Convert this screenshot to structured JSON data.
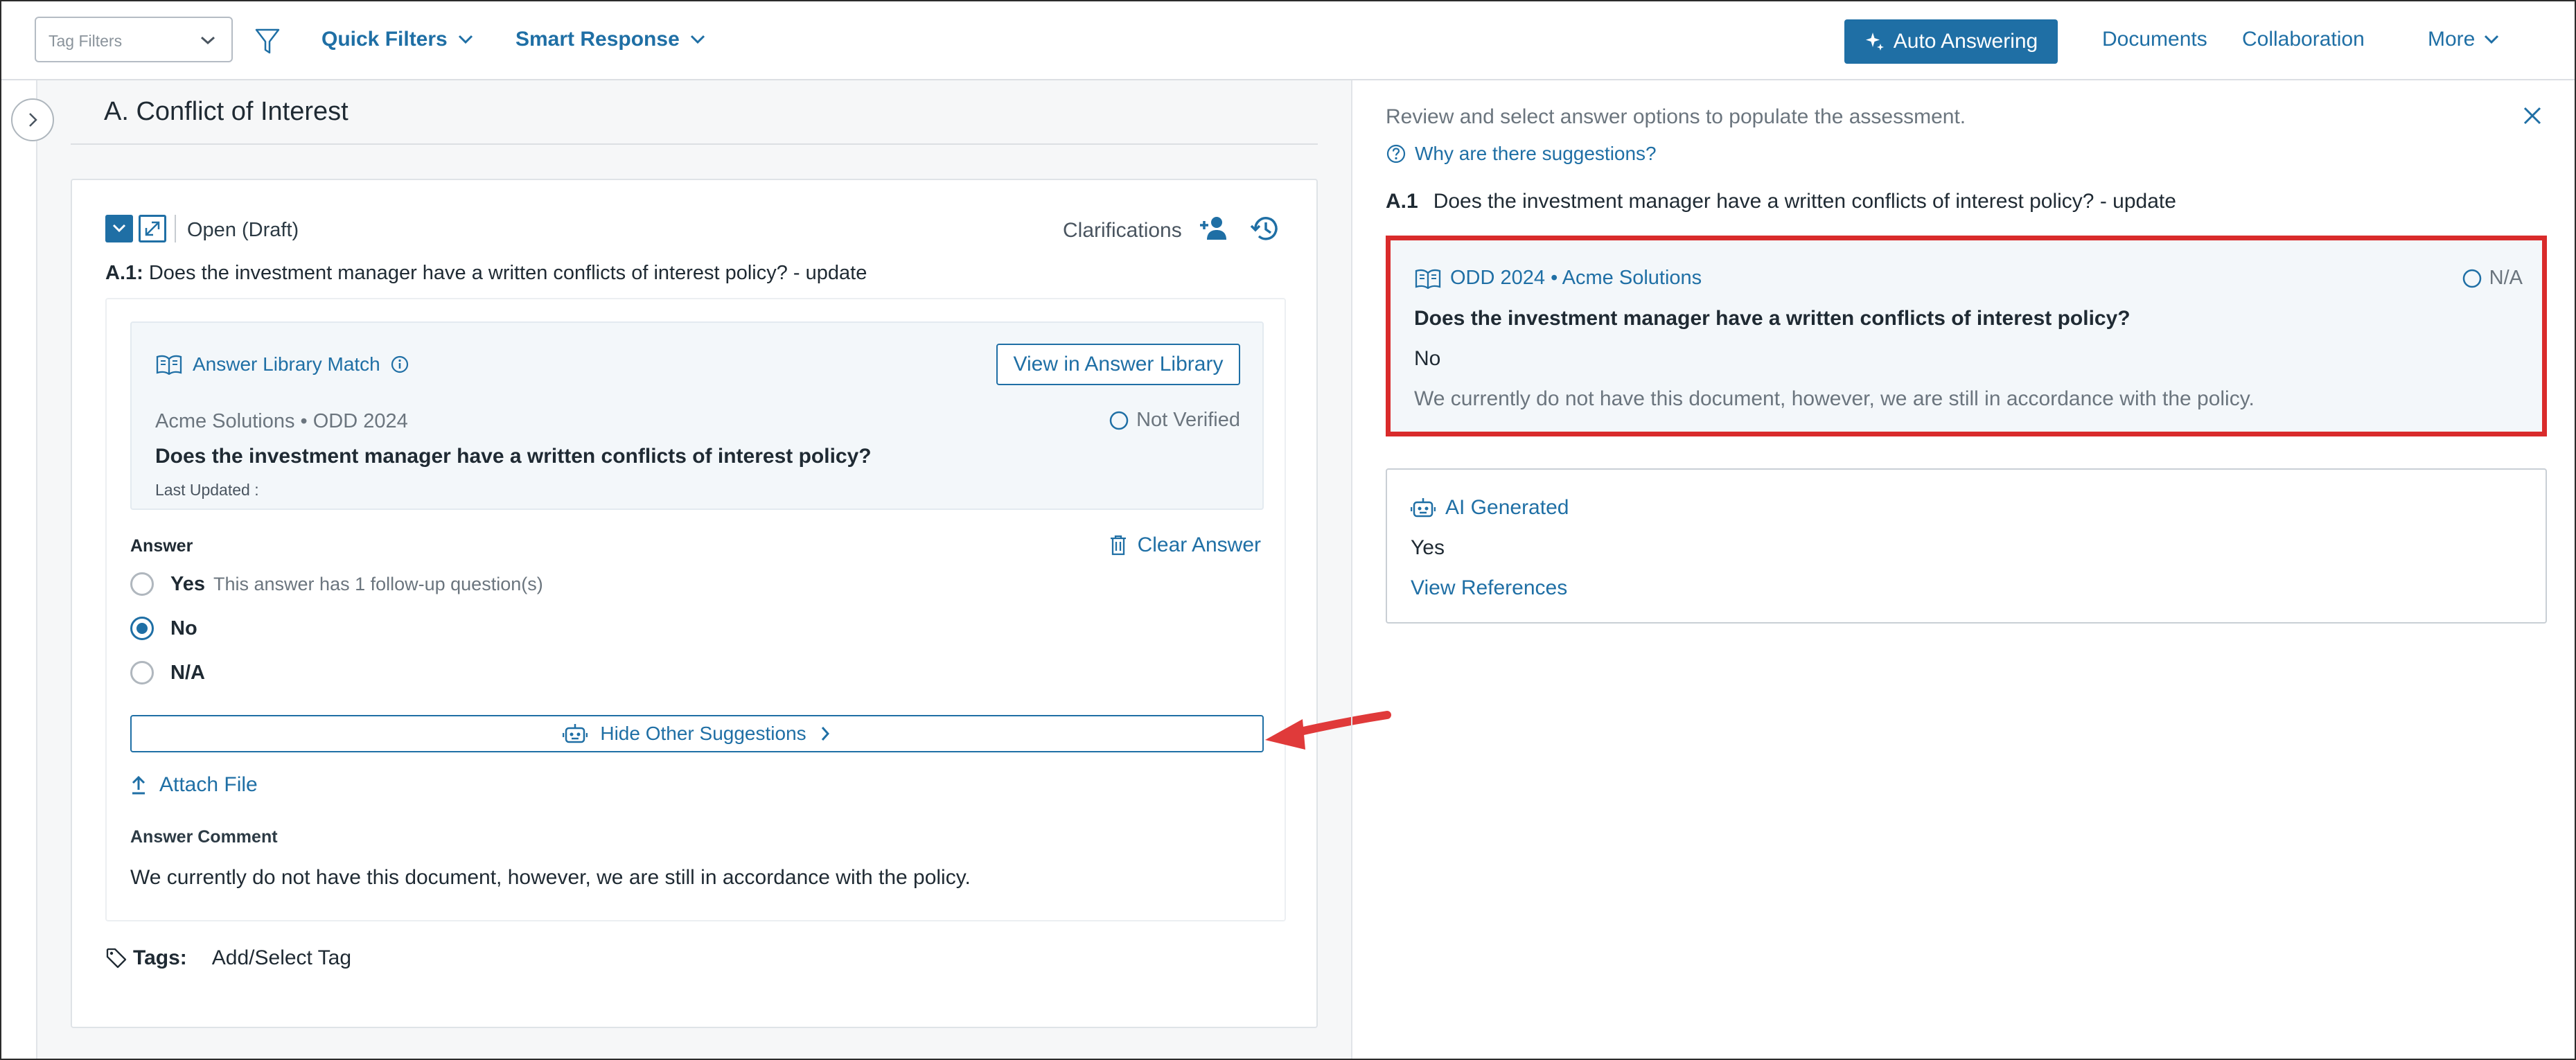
{
  "topbar": {
    "tag_filter_placeholder": "Tag Filters",
    "quick_filters": "Quick Filters",
    "smart_response": "Smart Response",
    "auto_answering": "Auto Answering",
    "documents": "Documents",
    "collaboration": "Collaboration",
    "more": "More"
  },
  "section": {
    "title": "A. Conflict of Interest"
  },
  "question_card": {
    "status": "Open (Draft)",
    "clarifications": "Clarifications",
    "question_id": "A.1:",
    "question_text": "Does the investment manager have a written conflicts of interest policy? - update",
    "library_match": {
      "label": "Answer Library Match",
      "view_button": "View in Answer Library",
      "source": "Acme Solutions • ODD 2024",
      "verification": "Not Verified",
      "question": "Does the investment manager have a written conflicts of interest policy?",
      "last_updated": "Last Updated :"
    },
    "answer_label": "Answer",
    "clear_answer": "Clear Answer",
    "options": [
      {
        "label": "Yes",
        "note": "This answer has 1 follow-up question(s)",
        "selected": false
      },
      {
        "label": "No",
        "note": "",
        "selected": true
      },
      {
        "label": "N/A",
        "note": "",
        "selected": false
      }
    ],
    "hide_suggestions": "Hide Other Suggestions",
    "attach_file": "Attach File",
    "comment_label": "Answer Comment",
    "comment_text": "We currently do not have this document, however, we are still in accordance with the policy.",
    "tags_label": "Tags:",
    "add_tag": "Add/Select Tag"
  },
  "right_panel": {
    "intro": "Review and select answer options to populate the assessment.",
    "why_link": "Why are there suggestions?",
    "question_id": "A.1",
    "question_text": "Does the investment manager have a written conflicts of interest policy? - update",
    "suggestion": {
      "source": "ODD 2024 • Acme Solutions",
      "verification": "N/A",
      "question": "Does the investment manager have a written conflicts of interest policy?",
      "answer": "No",
      "comment": "We currently do not have this document, however, we are still in accordance with the policy."
    },
    "ai": {
      "label": "AI Generated",
      "answer": "Yes",
      "references": "View References"
    }
  },
  "colors": {
    "accent": "#1f6fa5",
    "highlight_border": "#d92b2b",
    "annotation_arrow": "#e03a3a"
  }
}
